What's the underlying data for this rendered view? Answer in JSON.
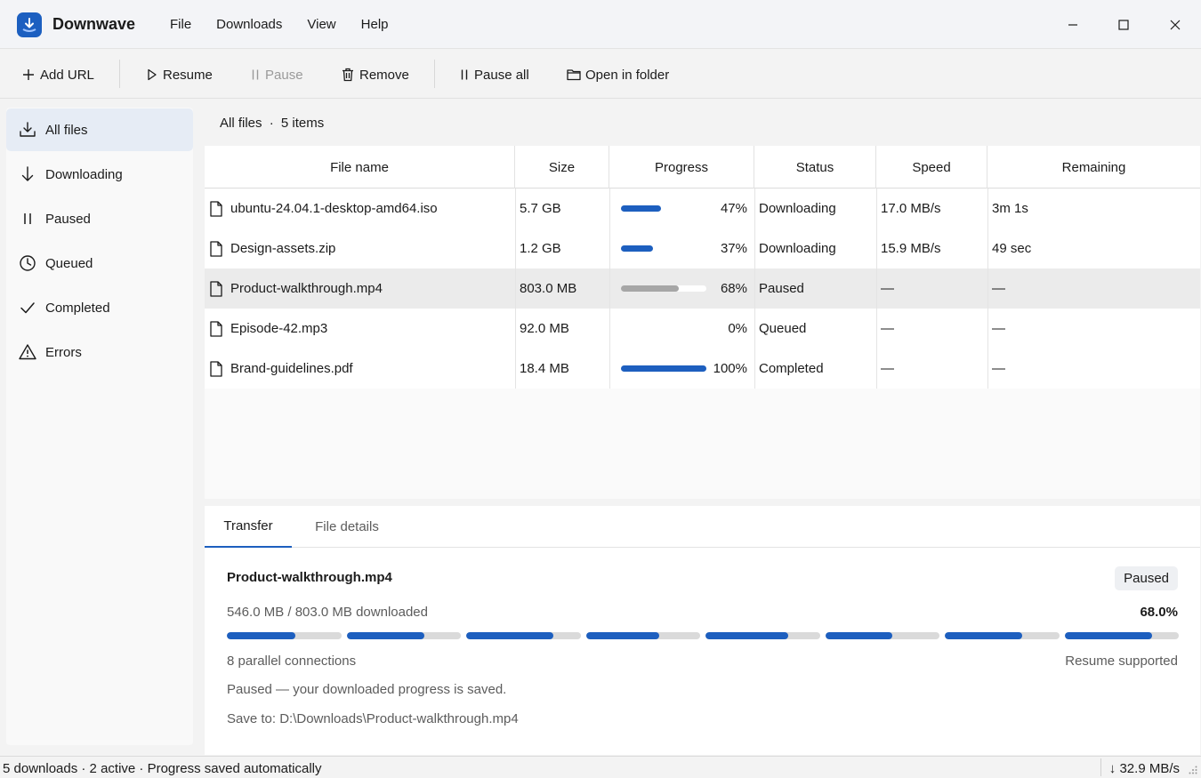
{
  "app": {
    "name": "Downwave"
  },
  "menu": [
    "File",
    "Downloads",
    "View",
    "Help"
  ],
  "toolbar": {
    "add_url": "Add URL",
    "resume": "Resume",
    "pause": "Pause",
    "remove": "Remove",
    "pause_all": "Pause all",
    "open_folder": "Open in folder"
  },
  "sidebar": {
    "items": [
      {
        "label": "All files",
        "icon": "download-tray-icon",
        "active": true
      },
      {
        "label": "Downloading",
        "icon": "arrow-down-icon"
      },
      {
        "label": "Paused",
        "icon": "pause-icon"
      },
      {
        "label": "Queued",
        "icon": "clock-icon"
      },
      {
        "label": "Completed",
        "icon": "check-icon"
      },
      {
        "label": "Errors",
        "icon": "warning-icon"
      }
    ]
  },
  "breadcrumb": {
    "section": "All files",
    "separator": "·",
    "count": "5 items"
  },
  "table": {
    "columns": [
      "File name",
      "Size",
      "Progress",
      "Status",
      "Speed",
      "Remaining"
    ],
    "rows": [
      {
        "name": "ubuntu-24.04.1-desktop-amd64.iso",
        "size": "5.7 GB",
        "progress": 47,
        "progress_label": "47%",
        "status": "Downloading",
        "speed": "17.0 MB/s",
        "remaining": "3m 1s",
        "state": "active"
      },
      {
        "name": "Design-assets.zip",
        "size": "1.2 GB",
        "progress": 37,
        "progress_label": "37%",
        "status": "Downloading",
        "speed": "15.9 MB/s",
        "remaining": "49 sec",
        "state": "active"
      },
      {
        "name": "Product-walkthrough.mp4",
        "size": "803.0 MB",
        "progress": 68,
        "progress_label": "68%",
        "status": "Paused",
        "speed": "—",
        "remaining": "—",
        "state": "paused",
        "selected": true
      },
      {
        "name": "Episode-42.mp3",
        "size": "92.0 MB",
        "progress": 0,
        "progress_label": "0%",
        "status": "Queued",
        "speed": "—",
        "remaining": "—",
        "state": "queued"
      },
      {
        "name": "Brand-guidelines.pdf",
        "size": "18.4 MB",
        "progress": 100,
        "progress_label": "100%",
        "status": "Completed",
        "speed": "—",
        "remaining": "—",
        "state": "done"
      }
    ]
  },
  "details": {
    "tabs": [
      "Transfer",
      "File details"
    ],
    "file_name": "Product-walkthrough.mp4",
    "badge": "Paused",
    "downloaded": "546.0 MB / 803.0 MB downloaded",
    "percent": "68.0%",
    "segments": [
      60,
      68,
      76,
      64,
      72,
      59,
      68,
      77
    ],
    "connections": "8 parallel connections",
    "resume": "Resume supported",
    "paused_note": "Paused — your downloaded progress is saved.",
    "save_to": "Save to: D:\\Downloads\\Product-walkthrough.mp4"
  },
  "statusbar": {
    "left": "5 downloads · 2 active · Progress saved automatically",
    "right": "↓ 32.9 MB/s"
  },
  "colors": {
    "accent": "#1d5fbf",
    "paused_bar": "#a6a6a6"
  }
}
